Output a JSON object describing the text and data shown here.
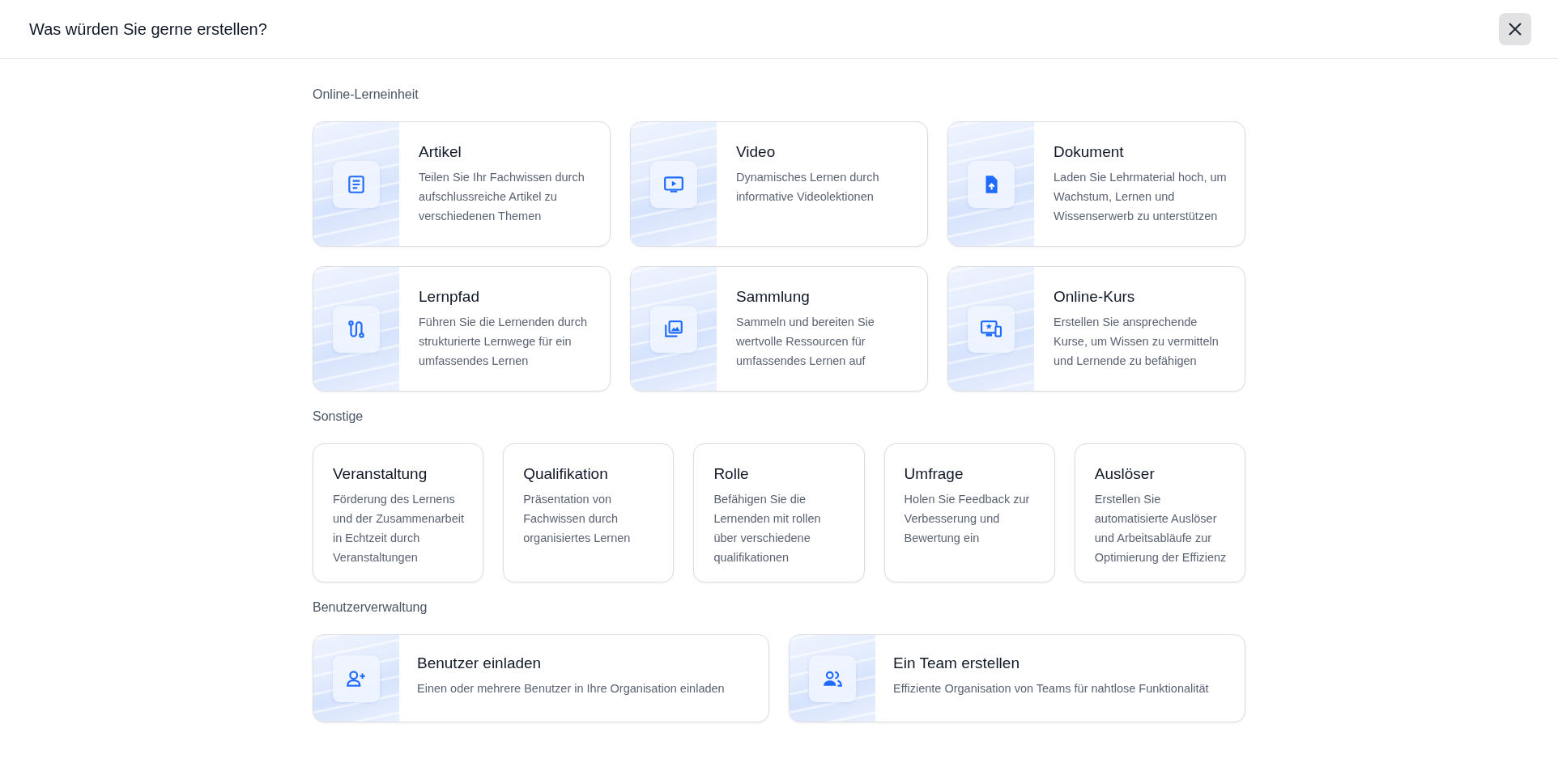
{
  "dialog": {
    "title": "Was würden Sie gerne erstellen?"
  },
  "sections": [
    {
      "label": "Online-Lerneinheit",
      "kind": "media",
      "cards": [
        {
          "title": "Artikel",
          "description": "Teilen Sie Ihr Fachwissen durch aufschlussreiche Artikel zu verschiedenen Themen"
        },
        {
          "title": "Video",
          "description": "Dynamisches Lernen durch informative Videolektionen"
        },
        {
          "title": "Dokument",
          "description": "Laden Sie Lehrmaterial hoch, um Wachstum, Lernen und Wissenserwerb zu unterstützen"
        },
        {
          "title": "Lernpfad",
          "description": "Führen Sie die Lernenden durch strukturierte Lernwege für ein umfassendes Lernen"
        },
        {
          "title": "Sammlung",
          "description": "Sammeln und bereiten Sie wertvolle Ressourcen für umfassendes Lernen auf"
        },
        {
          "title": "Online-Kurs",
          "description": "Erstellen Sie ansprechende Kurse, um Wissen zu vermitteln und Lernende zu befähigen"
        }
      ]
    },
    {
      "label": "Sonstige",
      "kind": "text",
      "cards": [
        {
          "title": "Veranstaltung",
          "description": "Förderung des Lernens und der Zusammenarbeit in Echtzeit durch Veranstaltungen"
        },
        {
          "title": "Qualifikation",
          "description": "Präsentation von Fachwissen durch organisiertes Lernen"
        },
        {
          "title": "Rolle",
          "description": "Befähigen Sie die Lernenden mit rollen über verschiedene qualifikationen"
        },
        {
          "title": "Umfrage",
          "description": "Holen Sie Feedback zur Verbesserung und Bewertung ein"
        },
        {
          "title": "Auslöser",
          "description": "Erstellen Sie automatisierte Auslöser und Arbeitsabläufe zur Optimierung der Effizienz"
        }
      ]
    },
    {
      "label": "Benutzerverwaltung",
      "kind": "media",
      "cards": [
        {
          "title": "Benutzer einladen",
          "description": "Einen oder mehrere Benutzer in Ihre Organisation einladen"
        },
        {
          "title": "Ein Team erstellen",
          "description": "Effiziente Organisation von Teams für nahtlose Funktionalität"
        }
      ]
    }
  ]
}
